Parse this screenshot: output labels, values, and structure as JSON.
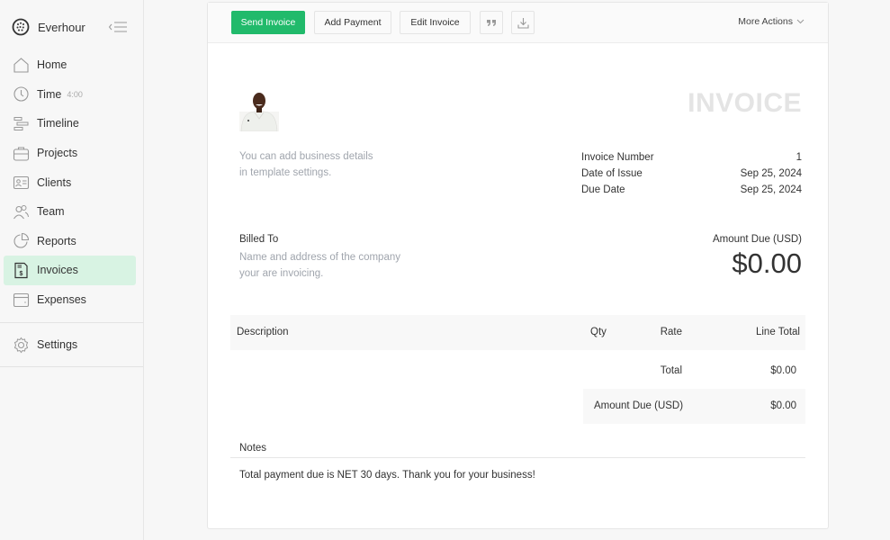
{
  "app": {
    "name": "Everhour"
  },
  "sidebar": {
    "items": [
      {
        "label": "Home",
        "icon": "home-icon"
      },
      {
        "label": "Time",
        "icon": "clock-icon",
        "badge": "4:00"
      },
      {
        "label": "Timeline",
        "icon": "timeline-icon"
      },
      {
        "label": "Projects",
        "icon": "briefcase-icon"
      },
      {
        "label": "Clients",
        "icon": "client-card-icon"
      },
      {
        "label": "Team",
        "icon": "team-icon"
      },
      {
        "label": "Reports",
        "icon": "pie-chart-icon"
      },
      {
        "label": "Invoices",
        "icon": "invoice-icon",
        "active": true
      },
      {
        "label": "Expenses",
        "icon": "wallet-icon"
      }
    ],
    "settings": {
      "label": "Settings",
      "icon": "gear-icon"
    }
  },
  "toolbar": {
    "send_invoice": "Send Invoice",
    "add_payment": "Add Payment",
    "edit_invoice": "Edit Invoice",
    "quote_icon": "quote-icon",
    "download_icon": "download-icon",
    "more_actions": "More Actions"
  },
  "invoice": {
    "title": "INVOICE",
    "business_note_line1": "You can add business details",
    "business_note_line2": "in template settings.",
    "meta": [
      {
        "label": "Invoice Number",
        "value": "1"
      },
      {
        "label": "Date of Issue",
        "value": "Sep 25, 2024"
      },
      {
        "label": "Due Date",
        "value": "Sep 25, 2024"
      }
    ],
    "billed_to_label": "Billed To",
    "billed_note_line1": "Name and address of the company",
    "billed_note_line2": "your are invoicing.",
    "amount_due_label": "Amount Due (USD)",
    "amount_due_value": "$0.00",
    "table": {
      "headers": {
        "description": "Description",
        "qty": "Qty",
        "rate": "Rate",
        "line_total": "Line Total"
      },
      "total_label": "Total",
      "total_value": "$0.00",
      "amount_due_label": "Amount Due (USD)",
      "amount_due_value": "$0.00"
    },
    "notes_label": "Notes",
    "notes_text": "Total payment due is NET 30 days. Thank you for your business!"
  },
  "colors": {
    "accent": "#21ba6b",
    "active_nav_bg": "#d8f3e3"
  }
}
